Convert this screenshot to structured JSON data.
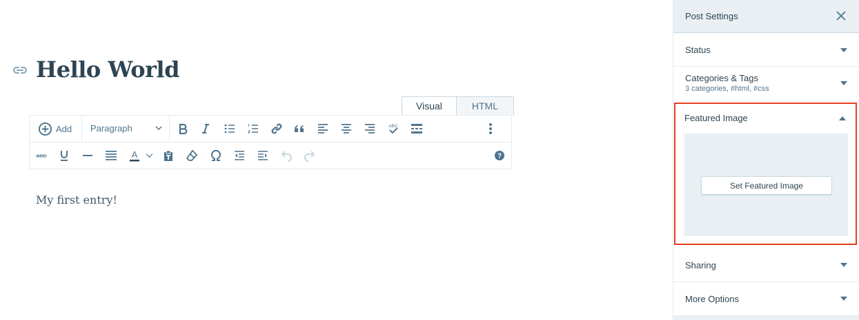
{
  "editor": {
    "title": "Hello World",
    "content": "My first entry!",
    "tabs": [
      {
        "label": "Visual"
      },
      {
        "label": "HTML"
      }
    ],
    "toolbar": {
      "add_label": "Add",
      "format_value": "Paragraph"
    },
    "icons": {
      "link": "link-icon",
      "add": "plus-circle-icon"
    },
    "abc_label": "ABC",
    "abc_strike_label": "ABC",
    "text_color_letter": "A",
    "help_glyph": "?"
  },
  "sidebar": {
    "title": "Post Settings",
    "panels": {
      "status": {
        "title": "Status"
      },
      "categories": {
        "title": "Categories & Tags",
        "subtitle": "3 categories, #html, #css"
      },
      "featured": {
        "title": "Featured Image",
        "button_label": "Set Featured Image"
      },
      "sharing": {
        "title": "Sharing"
      },
      "more": {
        "title": "More Options"
      }
    }
  },
  "colors": {
    "text_primary": "#2e4453",
    "icon": "#4f748e",
    "border": "#e3ebf0",
    "panel_bg": "#e9eff3",
    "highlight": "#e33d1f"
  }
}
